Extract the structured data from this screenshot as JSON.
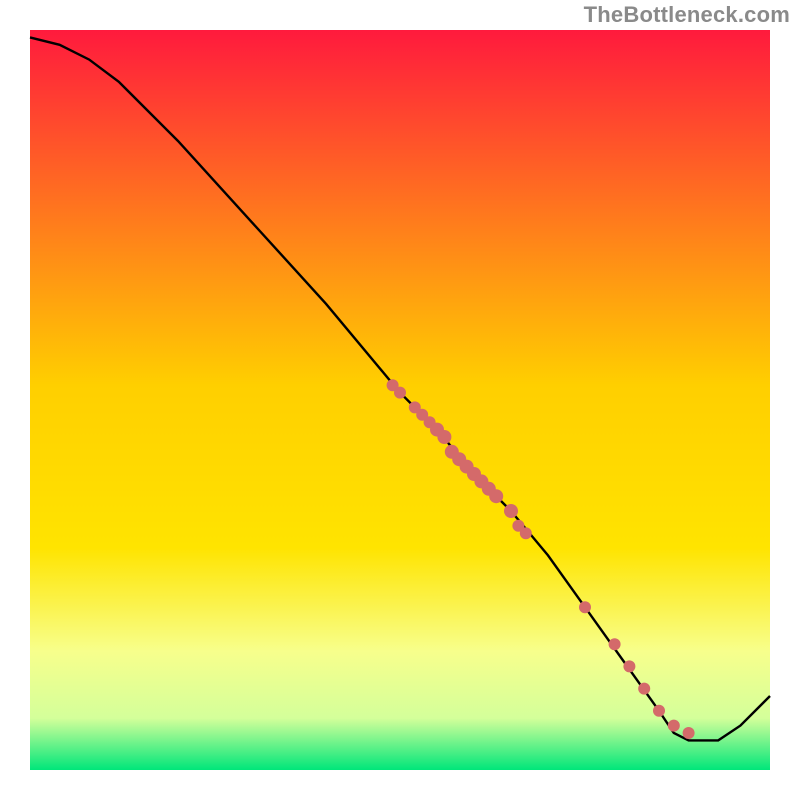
{
  "watermark": "TheBottleneck.com",
  "chart_data": {
    "type": "line",
    "title": "",
    "xlabel": "",
    "ylabel": "",
    "xlim": [
      0,
      100
    ],
    "ylim": [
      0,
      100
    ],
    "legend": false,
    "grid": false,
    "background_gradient": {
      "top_color": "#ff1a3d",
      "mid_color": "#ffe400",
      "lower_color_1": "#f7ff8c",
      "lower_color_2": "#d4ff9a",
      "bottom_color": "#00e67a"
    },
    "curve": {
      "description": "Descending bottleneck-percentage curve; starts near top-left, descends to a flat minimum near x≈87-93, then rises at far right",
      "x": [
        0,
        4,
        8,
        12,
        20,
        30,
        40,
        50,
        55,
        60,
        65,
        70,
        75,
        80,
        85,
        87,
        89,
        91,
        93,
        96,
        100
      ],
      "y": [
        99,
        98,
        96,
        93,
        85,
        74,
        63,
        51,
        46,
        40,
        35,
        29,
        22,
        15,
        8,
        5,
        4,
        4,
        4,
        6,
        10
      ]
    },
    "markers": {
      "description": "Highlighted points on the descending segment (salmon dots)",
      "color": "#d46a6a",
      "points": [
        {
          "x": 49,
          "y": 52,
          "r": 6
        },
        {
          "x": 50,
          "y": 51,
          "r": 6
        },
        {
          "x": 52,
          "y": 49,
          "r": 6
        },
        {
          "x": 53,
          "y": 48,
          "r": 6
        },
        {
          "x": 54,
          "y": 47,
          "r": 6
        },
        {
          "x": 55,
          "y": 46,
          "r": 7
        },
        {
          "x": 56,
          "y": 45,
          "r": 7
        },
        {
          "x": 57,
          "y": 43,
          "r": 7
        },
        {
          "x": 58,
          "y": 42,
          "r": 7
        },
        {
          "x": 59,
          "y": 41,
          "r": 7
        },
        {
          "x": 60,
          "y": 40,
          "r": 7
        },
        {
          "x": 61,
          "y": 39,
          "r": 7
        },
        {
          "x": 62,
          "y": 38,
          "r": 7
        },
        {
          "x": 63,
          "y": 37,
          "r": 7
        },
        {
          "x": 65,
          "y": 35,
          "r": 7
        },
        {
          "x": 66,
          "y": 33,
          "r": 6
        },
        {
          "x": 67,
          "y": 32,
          "r": 6
        },
        {
          "x": 75,
          "y": 22,
          "r": 6
        },
        {
          "x": 79,
          "y": 17,
          "r": 6
        },
        {
          "x": 81,
          "y": 14,
          "r": 6
        },
        {
          "x": 83,
          "y": 11,
          "r": 6
        },
        {
          "x": 85,
          "y": 8,
          "r": 6
        },
        {
          "x": 87,
          "y": 6,
          "r": 6
        },
        {
          "x": 89,
          "y": 5,
          "r": 6
        }
      ]
    }
  }
}
